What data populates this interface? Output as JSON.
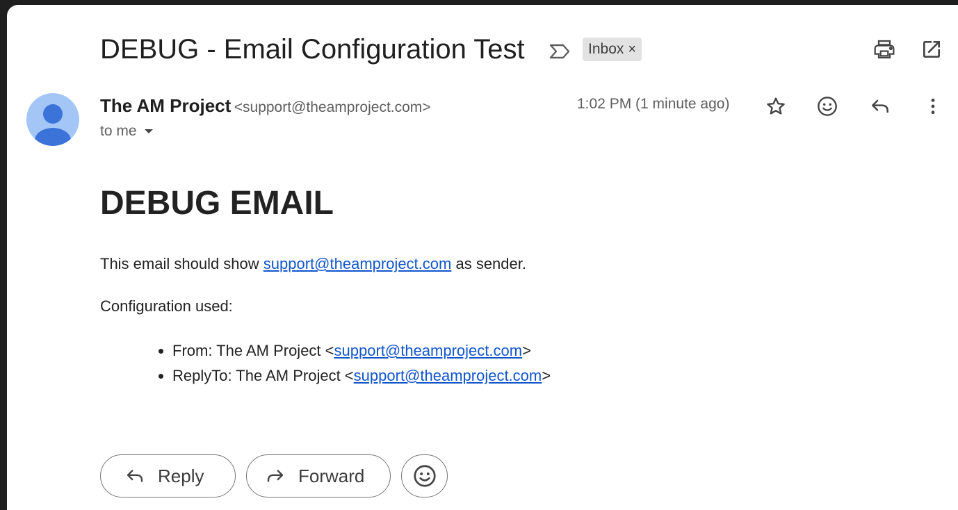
{
  "email": {
    "subject": "DEBUG - Email Configuration Test",
    "label": "Inbox",
    "label_remove": "×",
    "sender_name": "The AM Project",
    "sender_email": "<support@theamproject.com>",
    "recipient": "to me",
    "time": "1:02 PM (1 minute ago)"
  },
  "body": {
    "heading": "DEBUG EMAIL",
    "line1_pre": "This email should show ",
    "line1_link": "support@theamproject.com",
    "line1_post": " as sender.",
    "line2": "Configuration used:",
    "items": [
      {
        "pre": "From: The AM Project <",
        "link": "support@theamproject.com",
        "post": ">"
      },
      {
        "pre": "ReplyTo: The AM Project <",
        "link": "support@theamproject.com",
        "post": ">"
      }
    ]
  },
  "actions": {
    "reply_label": "Reply",
    "forward_label": "Forward"
  },
  "colors": {
    "link": "#1155cc",
    "avatar_bg": "#a3c6f7",
    "avatar_fg": "#3b73d9",
    "chip_bg": "#e2e2e2"
  },
  "icons": [
    "importance-marker-icon",
    "print-icon",
    "open-in-new-window-icon",
    "avatar-person-icon",
    "chevron-down-icon",
    "star-icon",
    "emoji-icon",
    "reply-icon",
    "more-vert-icon",
    "forward-icon"
  ]
}
